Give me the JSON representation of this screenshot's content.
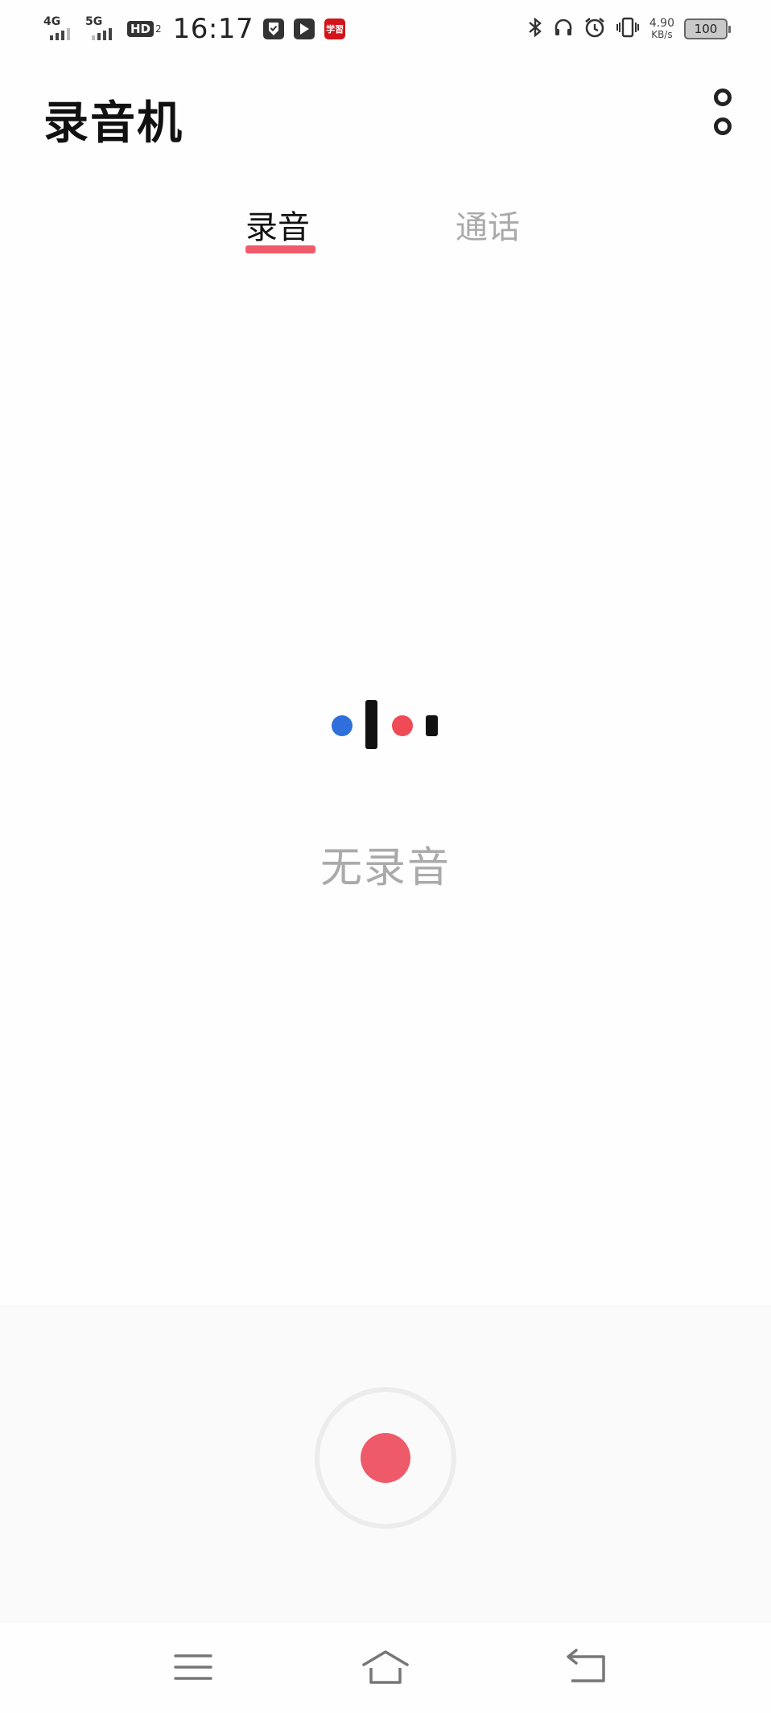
{
  "status_bar": {
    "network_1": "4G",
    "network_2": "5G",
    "hd_label": "HD",
    "hd_sub": "2",
    "time": "16:17",
    "app_icon_label": "学習",
    "speed_value": "4.90",
    "speed_unit": "KB/s",
    "battery": "100",
    "icons": [
      "signal-icon",
      "hd-voice-icon",
      "shield-check-icon",
      "play-icon",
      "app-notification-icon",
      "bluetooth-icon",
      "headphones-icon",
      "alarm-icon",
      "vibrate-icon",
      "battery-icon"
    ]
  },
  "header": {
    "title": "录音机",
    "more_icon": "more-options-icon"
  },
  "tabs": [
    {
      "label": "录音",
      "active": true
    },
    {
      "label": "通话",
      "active": false
    }
  ],
  "empty_state": {
    "text": "无录音",
    "colors": {
      "blue": "#2f6fdc",
      "red": "#ef4a55",
      "black": "#111111"
    }
  },
  "controls": {
    "record_icon": "record-icon",
    "accent": "#ee5a6a"
  },
  "nav_bar": {
    "icons": [
      "menu-icon",
      "home-icon",
      "back-icon"
    ]
  }
}
